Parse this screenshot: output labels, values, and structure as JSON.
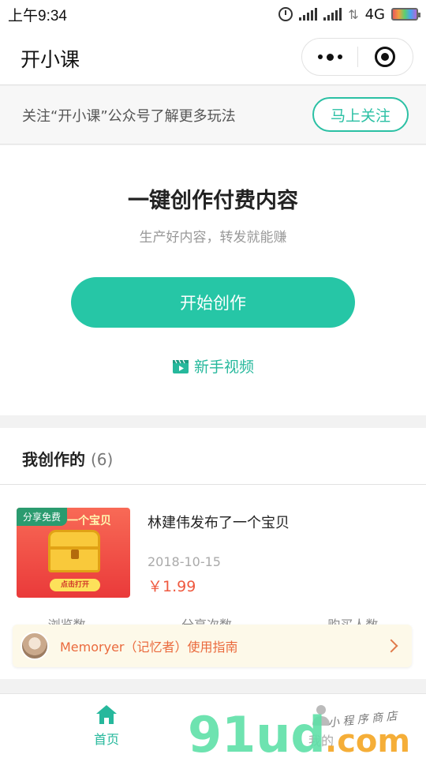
{
  "status_bar": {
    "time": "上午9:34",
    "network": "4G"
  },
  "title_bar": {
    "title": "开小课"
  },
  "follow_banner": {
    "text": "关注“开小课”公众号了解更多玩法",
    "button": "马上关注"
  },
  "hero": {
    "headline": "一键创作付费内容",
    "subline": "生产好内容，转发就能赚",
    "start_button": "开始创作",
    "video_link": "新手视频"
  },
  "my_creations": {
    "heading": "我创作的",
    "count": "(6)",
    "item": {
      "thumb_tag": "分享免费",
      "thumb_ribbon": "一个宝贝",
      "thumb_button": "点击打开",
      "title": "林建伟发布了一个宝贝",
      "date": "2018-10-15",
      "price": "￥1.99"
    },
    "stats": [
      "浏览数",
      "分享次数",
      "购买人数"
    ]
  },
  "guide_banner": {
    "text": "Memoryer（记忆者）使用指南"
  },
  "tab_bar": {
    "home": "首页",
    "mine": "我的"
  },
  "watermark": {
    "text": "91ud.com",
    "sub": "小程序商店"
  },
  "colors": {
    "accent": "#26c6a6",
    "price": "#ef5a40",
    "guide_text": "#ea6a3d"
  }
}
